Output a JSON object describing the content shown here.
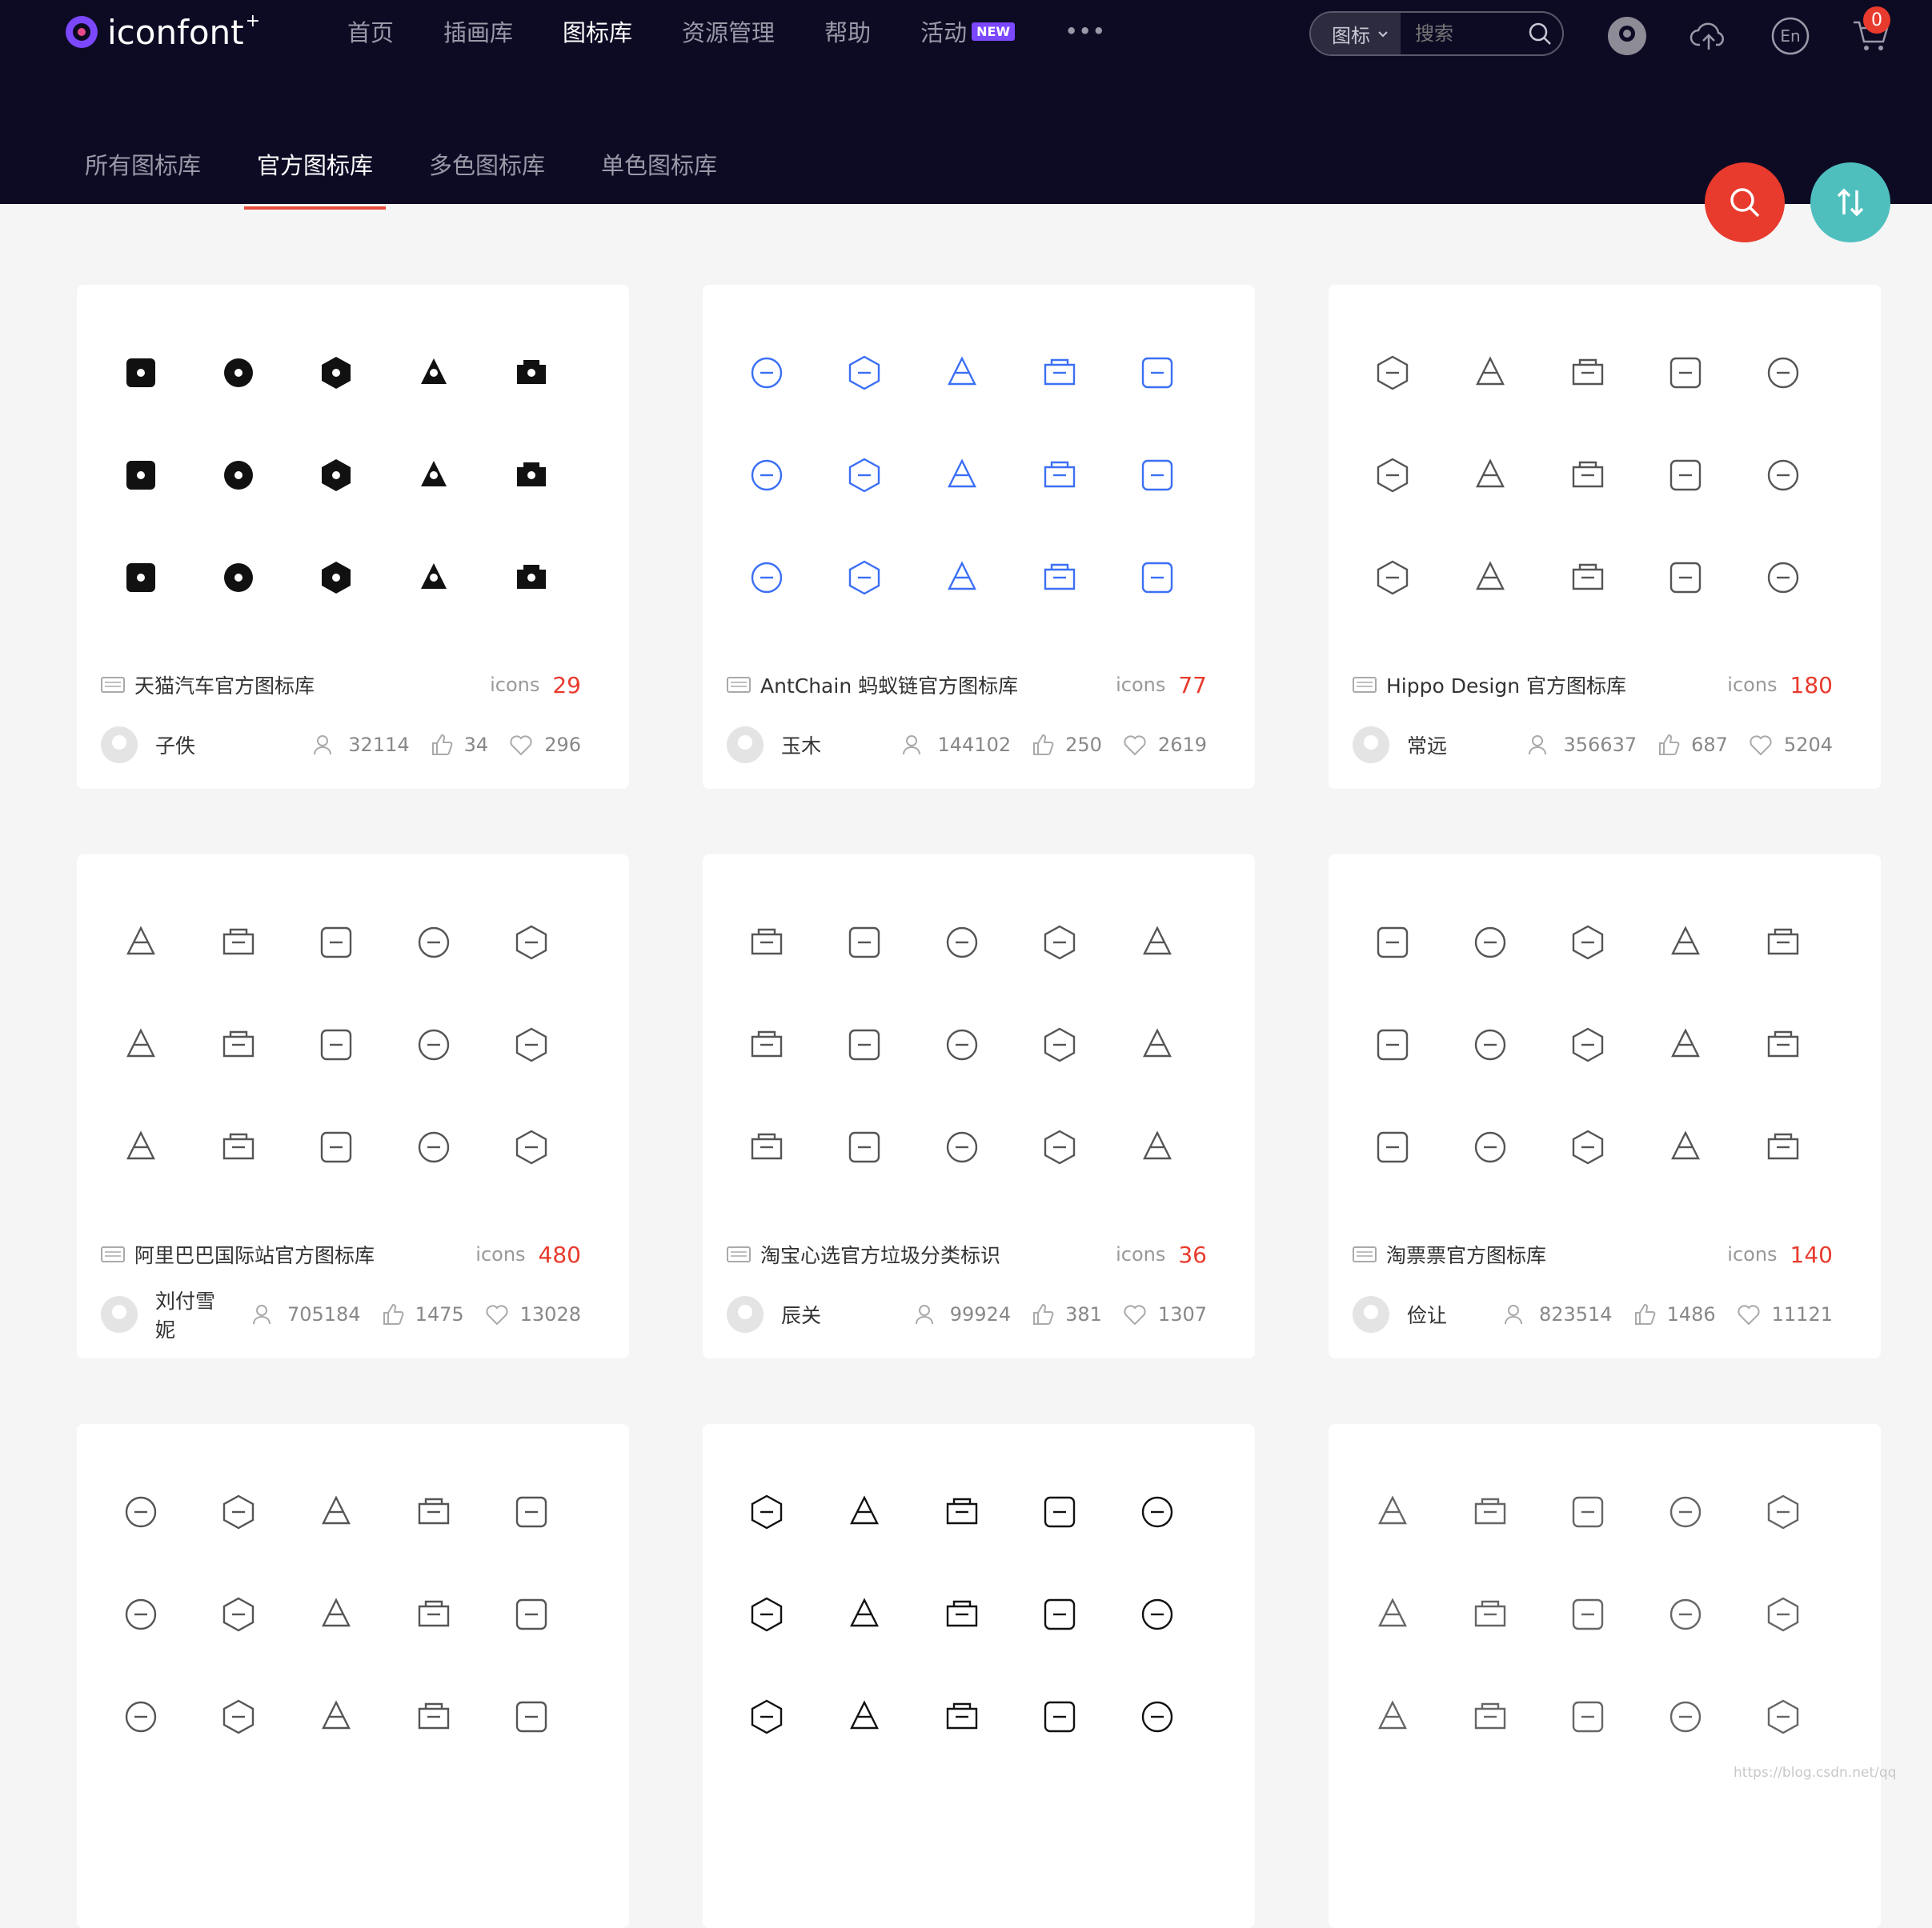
{
  "brand": {
    "name": "iconfont",
    "plus": "+"
  },
  "nav": [
    {
      "label": "首页",
      "active": false
    },
    {
      "label": "插画库",
      "active": false
    },
    {
      "label": "图标库",
      "active": true
    },
    {
      "label": "资源管理",
      "active": false
    },
    {
      "label": "帮助",
      "active": false
    },
    {
      "label": "活动",
      "active": false,
      "badge": "NEW"
    },
    {
      "label": "•••",
      "active": false
    }
  ],
  "search": {
    "type": "图标",
    "placeholder": "搜索"
  },
  "cart": {
    "count": "0"
  },
  "lang": "En",
  "subnav": [
    {
      "label": "所有图标库",
      "active": false
    },
    {
      "label": "官方图标库",
      "active": true
    },
    {
      "label": "多色图标库",
      "active": false
    },
    {
      "label": "单色图标库",
      "active": false
    }
  ],
  "cards": [
    {
      "title": "天猫汽车官方图标库",
      "icons_label": "icons",
      "icons_count": "29",
      "author": "子佚",
      "views": "32114",
      "likes": "34",
      "favorites": "296",
      "color": "#111111",
      "style": "solid"
    },
    {
      "title": "AntChain 蚂蚁链官方图标库",
      "icons_label": "icons",
      "icons_count": "77",
      "author": "玉木",
      "views": "144102",
      "likes": "250",
      "favorites": "2619",
      "color": "#3b6ff5",
      "style": "line"
    },
    {
      "title": "Hippo Design 官方图标库",
      "icons_label": "icons",
      "icons_count": "180",
      "author": "常远",
      "views": "356637",
      "likes": "687",
      "favorites": "5204",
      "color": "#555555",
      "style": "line"
    },
    {
      "title": "阿里巴巴国际站官方图标库",
      "icons_label": "icons",
      "icons_count": "480",
      "author": "刘付雪妮",
      "views": "705184",
      "likes": "1475",
      "favorites": "13028",
      "color": "#555555",
      "style": "line"
    },
    {
      "title": "淘宝心选官方垃圾分类标识",
      "icons_label": "icons",
      "icons_count": "36",
      "author": "辰关",
      "views": "99924",
      "likes": "381",
      "favorites": "1307",
      "color": "#555555",
      "style": "line"
    },
    {
      "title": "淘票票官方图标库",
      "icons_label": "icons",
      "icons_count": "140",
      "author": "俭让",
      "views": "823514",
      "likes": "1486",
      "favorites": "11121",
      "color": "#555555",
      "style": "line"
    },
    {
      "title": "",
      "icons_label": "",
      "icons_count": "",
      "author": "",
      "views": "",
      "likes": "",
      "favorites": "",
      "color": "#555555",
      "style": "line"
    },
    {
      "title": "",
      "icons_label": "",
      "icons_count": "",
      "author": "",
      "views": "",
      "likes": "",
      "favorites": "",
      "color": "#111111",
      "style": "line"
    },
    {
      "title": "",
      "icons_label": "",
      "icons_count": "",
      "author": "",
      "views": "",
      "likes": "",
      "favorites": "",
      "color": "#666666",
      "style": "line"
    }
  ],
  "watermark": "https://blog.csdn.net/qq"
}
